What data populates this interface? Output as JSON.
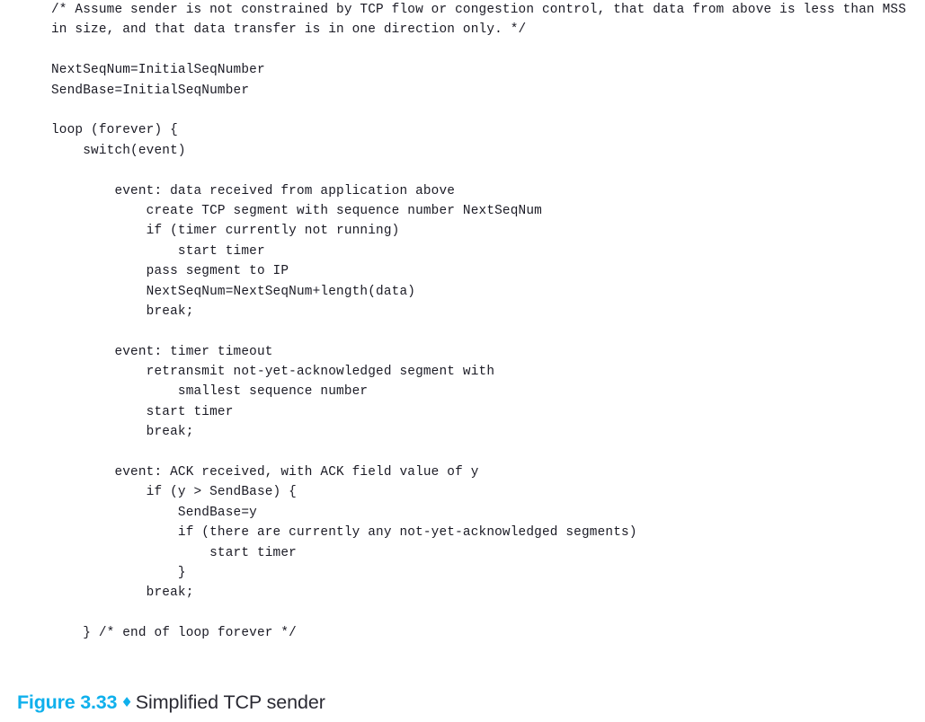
{
  "figure": {
    "caption_label": "Figure 3.33",
    "caption_diamond": "♦",
    "caption_text": "Simplified TCP sender",
    "accent_color": "#0fb0ec",
    "text_color": "#1a1a24",
    "background_color": "#ffffff"
  },
  "code": {
    "language": "pseudocode",
    "lines": [
      "/* Assume sender is not constrained by TCP flow or congestion control, that data from above is less than MSS in size, and that data transfer is in one direction only. */",
      "",
      "NextSeqNum=InitialSeqNumber",
      "SendBase=InitialSeqNumber",
      "",
      "loop (forever) {",
      "    switch(event)",
      "",
      "        event: data received from application above",
      "            create TCP segment with sequence number NextSeqNum",
      "            if (timer currently not running)",
      "                start timer",
      "            pass segment to IP",
      "            NextSeqNum=NextSeqNum+length(data)",
      "            break;",
      "",
      "        event: timer timeout",
      "            retransmit not-yet-acknowledged segment with",
      "                smallest sequence number",
      "            start timer",
      "            break;",
      "",
      "        event: ACK received, with ACK field value of y",
      "            if (y > SendBase) {",
      "                SendBase=y",
      "                if (there are currently any not-yet-acknowledged segments)",
      "                    start timer",
      "                }",
      "            break;",
      "",
      "    } /* end of loop forever */"
    ]
  }
}
